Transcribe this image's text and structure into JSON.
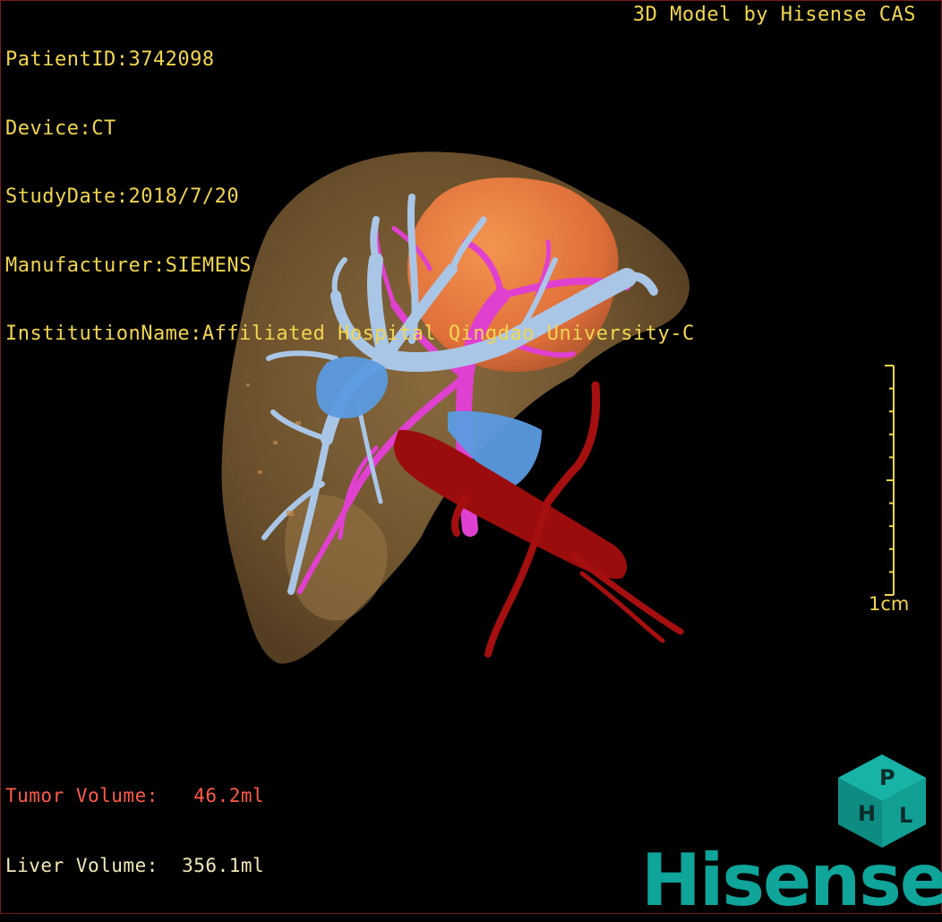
{
  "patient_info": [
    "PatientID:3742098",
    "Device:CT",
    "StudyDate:2018/7/20",
    "Manufacturer:SIEMENS",
    "InstitutionName:Affiliated Hospital Qingdao University-C"
  ],
  "header": {
    "model_credit": "3D Model by Hisense CAS"
  },
  "volumes": {
    "tumor": "Tumor Volume:   46.2ml",
    "liver": "Liver Volume:  356.1ml"
  },
  "scale": {
    "label": "1cm"
  },
  "logo": {
    "word": "Hisense",
    "cube_letters": [
      "H",
      "P",
      "L"
    ]
  },
  "colors": {
    "hud_text": "#f2d64f",
    "tumor_text": "#ff5a4a",
    "liver": "#8a6a3c",
    "tumor": "#f07a3a",
    "portal_vein": "#a9c6e6",
    "hepatic_vein": "#5b9be0",
    "artery": "#e040d0",
    "ivc": "#9b0d0d",
    "brand": "#0fa59a"
  }
}
